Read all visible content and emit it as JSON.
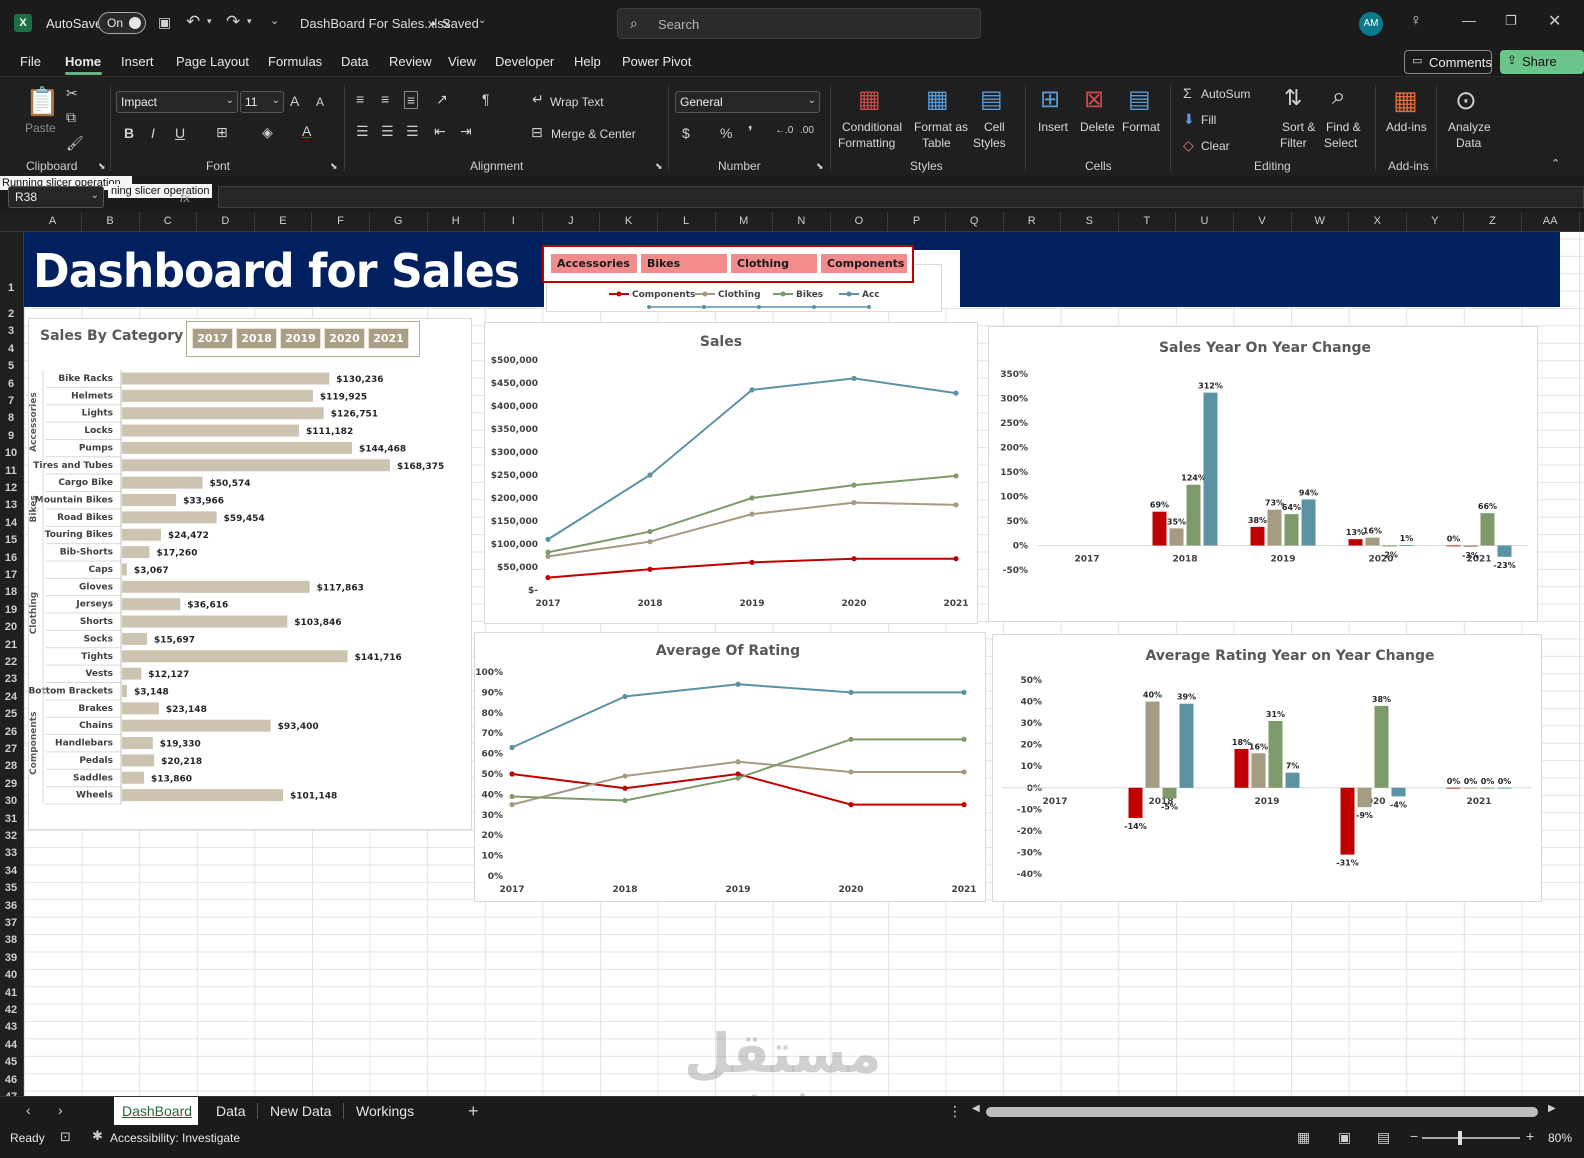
{
  "titlebar": {
    "autosave_label": "AutoSave",
    "autosave_state": "On",
    "file_name": "DashBoard For Sales.xlsx",
    "saved_label": "Saved",
    "search_placeholder": "Search",
    "avatar_initials": "AM"
  },
  "menu": {
    "items": [
      "File",
      "Home",
      "Insert",
      "Page Layout",
      "Formulas",
      "Data",
      "Review",
      "View",
      "Developer",
      "Help",
      "Power Pivot"
    ],
    "active": "Home",
    "comments_label": "Comments",
    "share_label": "Share"
  },
  "ribbon": {
    "clipboard": {
      "paste": "Paste",
      "group": "Clipboard"
    },
    "font": {
      "name": "Impact",
      "size": "11",
      "group": "Font"
    },
    "alignment": {
      "wrap": "Wrap Text",
      "merge": "Merge & Center",
      "group": "Alignment"
    },
    "number": {
      "format": "General",
      "group": "Number"
    },
    "styles": {
      "cond1": "Conditional",
      "cond2": "Formatting",
      "fmt1": "Format as",
      "fmt2": "Table",
      "cell1": "Cell",
      "cell2": "Styles",
      "group": "Styles"
    },
    "cells": {
      "insert": "Insert",
      "delete": "Delete",
      "format": "Format",
      "group": "Cells"
    },
    "editing": {
      "autosum": "AutoSum",
      "fill": "Fill",
      "clear": "Clear",
      "sort1": "Sort &",
      "sort2": "Filter",
      "find1": "Find &",
      "find2": "Select",
      "group": "Editing"
    },
    "addins": {
      "label": "Add-ins",
      "group": "Add-ins"
    },
    "analyze": {
      "l1": "Analyze",
      "l2": "Data"
    }
  },
  "formula_bar": {
    "name_box": "R38",
    "tooltip": "Running slicer operation...",
    "tooltip2": "ning slicer operation",
    "fx": "fx"
  },
  "columns": [
    "A",
    "B",
    "C",
    "D",
    "E",
    "F",
    "G",
    "H",
    "I",
    "J",
    "K",
    "L",
    "M",
    "N",
    "O",
    "P",
    "Q",
    "R",
    "S",
    "T",
    "U",
    "V",
    "W",
    "X",
    "Y",
    "Z",
    "AA"
  ],
  "rows": [
    "1",
    "2",
    "3",
    "4",
    "5",
    "6",
    "7",
    "8",
    "9",
    "10",
    "11",
    "12",
    "13",
    "14",
    "15",
    "16",
    "17",
    "18",
    "19",
    "20",
    "21",
    "22",
    "23",
    "24",
    "25",
    "26",
    "27",
    "28",
    "29",
    "30",
    "31",
    "32",
    "33",
    "34",
    "35",
    "36",
    "37",
    "38",
    "39",
    "40",
    "41",
    "42",
    "43",
    "44",
    "45",
    "46",
    "47",
    "48"
  ],
  "dashboard": {
    "title": "Dashboard for Sales",
    "category_slicer": [
      "Accessories",
      "Bikes",
      "Clothing",
      "Components"
    ],
    "legend": [
      "Components",
      "Clothing",
      "Bikes",
      "Accessories"
    ],
    "year_slicer": [
      "2017",
      "2018",
      "2019",
      "2020",
      "2021"
    ],
    "sales_by_category_title": "Sales By Category",
    "colors": {
      "components": "#c00000",
      "clothing": "#a59a82",
      "bikes": "#7f9a6a",
      "accessories": "#5b93a4",
      "bar": "#cdc3b1",
      "banner": "#012060"
    }
  },
  "chart_data": [
    {
      "type": "bar",
      "title": "Sales By Category",
      "orientation": "horizontal",
      "groups": [
        {
          "name": "Accessories",
          "categories": [
            "Bike Racks",
            "Helmets",
            "Lights",
            "Locks",
            "Pumps",
            "Tires and Tubes"
          ],
          "values": [
            130236,
            119925,
            126751,
            111182,
            144468,
            168375
          ],
          "labels": [
            "$130,236",
            "$119,925",
            "$126,751",
            "$111,182",
            "$144,468",
            "$168,375"
          ]
        },
        {
          "name": "Bikes",
          "categories": [
            "Cargo Bike",
            "Mountain Bikes",
            "Road Bikes",
            "Touring Bikes"
          ],
          "values": [
            50574,
            33966,
            59454,
            24472
          ],
          "labels": [
            "$50,574",
            "$33,966",
            "$59,454",
            "$24,472"
          ]
        },
        {
          "name": "Clothing",
          "categories": [
            "Bib-Shorts",
            "Caps",
            "Gloves",
            "Jerseys",
            "Shorts",
            "Socks",
            "Tights",
            "Vests"
          ],
          "values": [
            17260,
            3067,
            117863,
            36616,
            103846,
            15697,
            141716,
            12127
          ],
          "labels": [
            "$17,260",
            "$3,067",
            "$117,863",
            "$36,616",
            "$103,846",
            "$15,697",
            "$141,716",
            "$12,127"
          ]
        },
        {
          "name": "Components",
          "categories": [
            "Bottom Brackets",
            "Brakes",
            "Chains",
            "Handlebars",
            "Pedals",
            "Saddles",
            "Wheels"
          ],
          "values": [
            3148,
            23148,
            93400,
            19330,
            20218,
            13860,
            101148
          ],
          "labels": [
            "$3,148",
            "$23,148",
            "$93,400",
            "$19,330",
            "$20,218",
            "$13,860",
            "$101,148"
          ]
        }
      ]
    },
    {
      "type": "line",
      "title": "Sales",
      "x": [
        "2017",
        "2018",
        "2019",
        "2020",
        "2021"
      ],
      "yticks": [
        "$-",
        "$50,000",
        "$100,000",
        "$150,000",
        "$200,000",
        "$250,000",
        "$300,000",
        "$350,000",
        "$400,000",
        "$450,000",
        "$500,000"
      ],
      "ylim": [
        0,
        500000
      ],
      "series": [
        {
          "name": "Components",
          "values": [
            27000,
            45000,
            60000,
            68000,
            68000
          ]
        },
        {
          "name": "Clothing",
          "values": [
            73000,
            105000,
            165000,
            190000,
            185000
          ]
        },
        {
          "name": "Bikes",
          "values": [
            82000,
            127000,
            200000,
            228000,
            248000
          ]
        },
        {
          "name": "Accessories",
          "values": [
            110000,
            250000,
            435000,
            460000,
            428000
          ]
        }
      ]
    },
    {
      "type": "bar",
      "title": "Sales Year On Year Change",
      "categories": [
        "2017",
        "2018",
        "2019",
        "2020",
        "2021"
      ],
      "yticks": [
        "-50%",
        "0%",
        "50%",
        "100%",
        "150%",
        "200%",
        "250%",
        "300%",
        "350%"
      ],
      "ylim": [
        -50,
        350
      ],
      "series": [
        {
          "name": "Components",
          "values": [
            null,
            69,
            38,
            13,
            0
          ],
          "labels": [
            "",
            "69%",
            "38%",
            "13%",
            "0%"
          ]
        },
        {
          "name": "Clothing",
          "values": [
            null,
            35,
            73,
            16,
            -3
          ],
          "labels": [
            "",
            "35%",
            "73%",
            "16%",
            "-3%"
          ]
        },
        {
          "name": "Bikes",
          "values": [
            null,
            124,
            64,
            -2,
            66
          ],
          "labels": [
            "",
            "124%",
            "64%",
            "-2%",
            "66%"
          ]
        },
        {
          "name": "Accessories",
          "values": [
            null,
            312,
            94,
            1,
            -23
          ],
          "labels": [
            "",
            "312%",
            "94%",
            "1%",
            "-23%"
          ]
        }
      ]
    },
    {
      "type": "line",
      "title": "Average Of Rating",
      "x": [
        "2017",
        "2018",
        "2019",
        "2020",
        "2021"
      ],
      "yticks": [
        "0%",
        "10%",
        "20%",
        "30%",
        "40%",
        "50%",
        "60%",
        "70%",
        "80%",
        "90%",
        "100%"
      ],
      "ylim": [
        0,
        100
      ],
      "series": [
        {
          "name": "Components",
          "values": [
            50,
            43,
            50,
            35,
            35
          ]
        },
        {
          "name": "Clothing",
          "values": [
            35,
            49,
            56,
            51,
            51
          ]
        },
        {
          "name": "Bikes",
          "values": [
            39,
            37,
            48,
            67,
            67
          ]
        },
        {
          "name": "Accessories",
          "values": [
            63,
            88,
            94,
            90,
            90
          ]
        }
      ]
    },
    {
      "type": "bar",
      "title": "Average Rating Year on Year Change",
      "categories": [
        "2017",
        "2018",
        "2019",
        "2020",
        "2021"
      ],
      "yticks": [
        "-40%",
        "-30%",
        "-20%",
        "-10%",
        "0%",
        "10%",
        "20%",
        "30%",
        "40%",
        "50%"
      ],
      "ylim": [
        -40,
        50
      ],
      "series": [
        {
          "name": "Components",
          "values": [
            null,
            -14,
            18,
            -31,
            0
          ],
          "labels": [
            "",
            "-14%",
            "18%",
            "-31%",
            "0%"
          ]
        },
        {
          "name": "Clothing",
          "values": [
            null,
            40,
            16,
            -9,
            0
          ],
          "labels": [
            "",
            "40%",
            "16%",
            "-9%",
            "0%"
          ]
        },
        {
          "name": "Bikes",
          "values": [
            null,
            -5,
            31,
            38,
            0
          ],
          "labels": [
            "",
            "-5%",
            "31%",
            "38%",
            "0%"
          ]
        },
        {
          "name": "Accessories",
          "values": [
            null,
            39,
            7,
            -4,
            0
          ],
          "labels": [
            "",
            "39%",
            "7%",
            "-4%",
            "0%"
          ]
        }
      ]
    }
  ],
  "sheet_tabs": [
    "DashBoard",
    "Data",
    "New Data",
    "Workings"
  ],
  "active_tab": "DashBoard",
  "status": {
    "ready": "Ready",
    "accessibility": "Accessibility: Investigate",
    "zoom": "80%"
  },
  "watermark": {
    "arabic": "مستقل",
    "latin": "mostaql.com"
  }
}
